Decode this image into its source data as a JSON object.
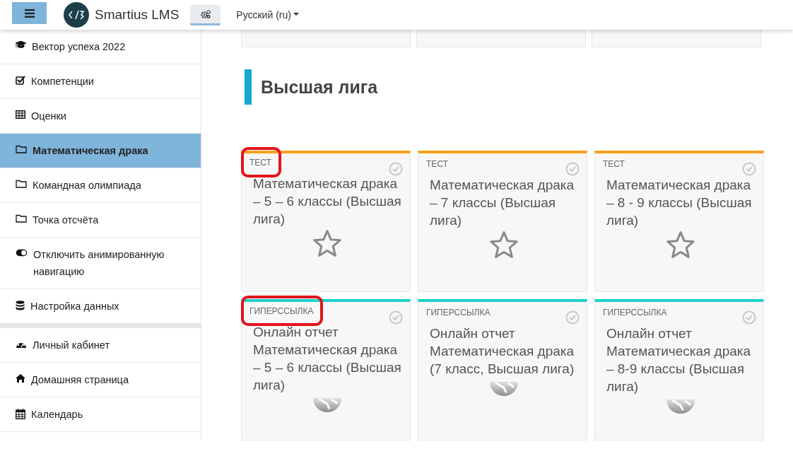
{
  "navbar": {
    "brand": "Smartius LMS",
    "language": "Русский (ru)"
  },
  "sidebar": {
    "groups": [
      {
        "items": [
          {
            "kind": "graduation",
            "label": "Вектор успеха 2022",
            "selected": false
          },
          {
            "kind": "checkbox",
            "label": "Компетенции",
            "selected": false
          },
          {
            "kind": "table",
            "label": "Оценки",
            "selected": false
          },
          {
            "kind": "folder",
            "label": "Математическая драка",
            "selected": true
          },
          {
            "kind": "folder",
            "label": "Командная олимпиада",
            "selected": false
          },
          {
            "kind": "folder",
            "label": "Точка отсчёта",
            "selected": false
          },
          {
            "kind": "toggle",
            "label": "Отключить анимированную навигацию",
            "selected": false
          },
          {
            "kind": "database",
            "label": "Настройка данных",
            "selected": false
          }
        ]
      },
      {
        "items": [
          {
            "kind": "dashboard",
            "label": "Личный кабинет",
            "selected": false
          },
          {
            "kind": "home",
            "label": "Домашняя страница",
            "selected": false
          },
          {
            "kind": "calendar",
            "label": "Календарь",
            "selected": false
          }
        ]
      }
    ]
  },
  "section": {
    "title": "Высшая лига",
    "cards": [
      {
        "kind": "quiz",
        "type": "ТЕСТ",
        "title": "Математическая драка – 5 – 6 классы (Высшая лига)",
        "color": "#f9a11b",
        "completed": false,
        "highlighted": true
      },
      {
        "kind": "quiz",
        "type": "ТЕСТ",
        "title": "Математическая драка – 7 классы (Высшая лига)",
        "color": "#f9a11b",
        "completed": false,
        "highlighted": false
      },
      {
        "kind": "quiz",
        "type": "ТЕСТ",
        "title": "Математическая драка – 8 - 9 классы (Высшая лига)",
        "color": "#f9a11b",
        "completed": false,
        "highlighted": false
      },
      {
        "kind": "url",
        "type": "ГИПЕРССЫЛКА",
        "title": "Онлайн отчет Математическая драка – 5 – 6 классы (Высшая лига)",
        "color": "#1fcfc9",
        "completed": false,
        "highlighted": true
      },
      {
        "kind": "url",
        "type": "ГИПЕРССЫЛКА",
        "title": "Онлайн отчет Математическая драка (7 класс, Высшая лига)",
        "color": "#1fcfc9",
        "completed": false,
        "highlighted": false
      },
      {
        "kind": "url",
        "type": "ГИПЕРССЫЛКА",
        "title": "Онлайн отчет Математическая драка – 8-9 классы (Высшая лига)",
        "color": "#1fcfc9",
        "completed": false,
        "highlighted": false
      }
    ]
  }
}
